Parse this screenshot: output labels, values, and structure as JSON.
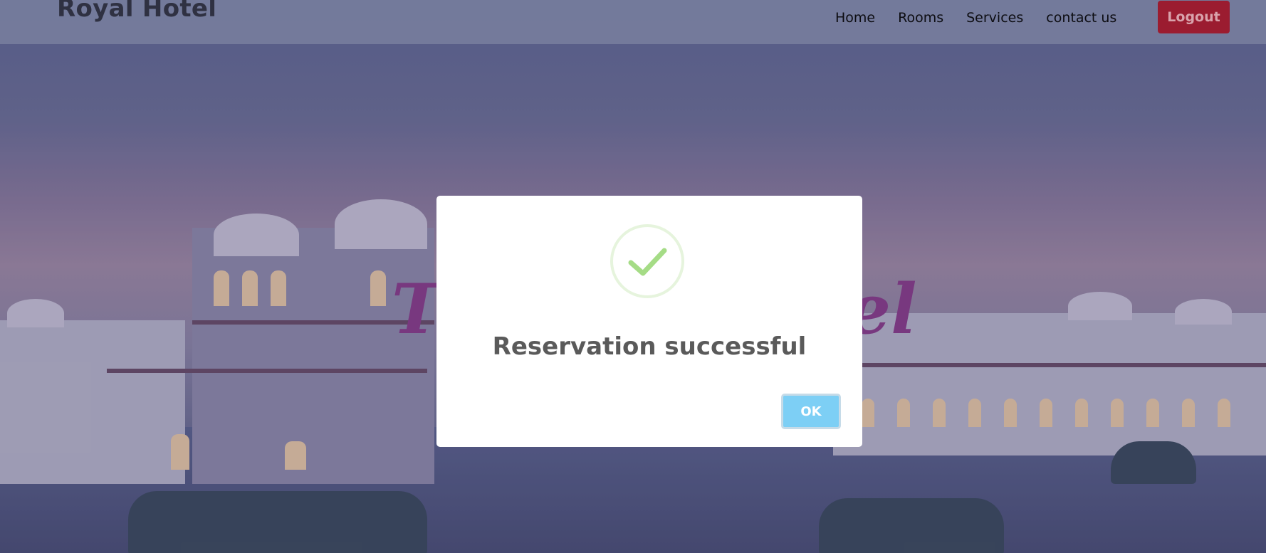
{
  "navbar": {
    "brand": "Royal Hotel",
    "links": [
      "Home",
      "Rooms",
      "Services",
      "contact us"
    ],
    "logout_label": "Logout"
  },
  "hero": {
    "partial_text_left": "T",
    "partial_text_right": "el"
  },
  "modal": {
    "icon": "checkmark-icon",
    "title": "Reservation successful",
    "ok_label": "OK"
  },
  "colors": {
    "logout": "#9b1c30",
    "ok_button": "#7dcff5",
    "checkmark": "#a5dc86"
  }
}
